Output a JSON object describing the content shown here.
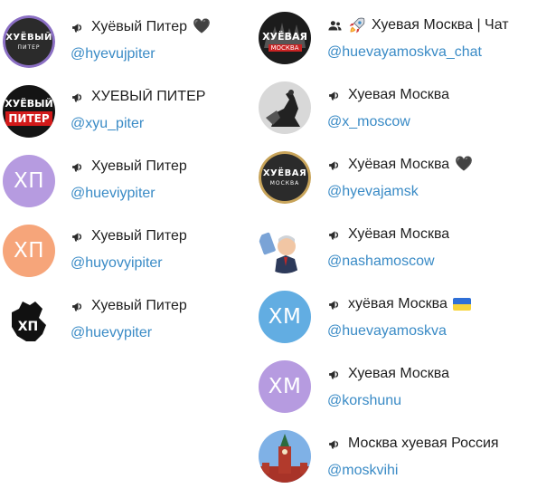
{
  "left": [
    {
      "name": "Хуёвый Питер",
      "handle": "@hyevujpiter",
      "suffix": "heart",
      "avatar": {
        "kind": "logo",
        "top": "ХУЁВЫЙ",
        "bottom": "ПИТЕР",
        "bg": "#2b2b2b",
        "ring": "#8b6fc4"
      }
    },
    {
      "name": "ХУЕВЫЙ ПИТЕР",
      "handle": "@xyu_piter",
      "suffix": "",
      "avatar": {
        "kind": "logo2",
        "top": "ХУЁВЫЙ",
        "bottom": "ПИТЕР",
        "bg": "#141414",
        "accent": "#d21a1a"
      }
    },
    {
      "name": "Хуевый Питер",
      "handle": "@hueviypiter",
      "suffix": "",
      "avatar": {
        "kind": "text",
        "text": "ХП",
        "bg": "#b69be0"
      }
    },
    {
      "name": "Хуевый Питер",
      "handle": "@huyovyipiter",
      "suffix": "",
      "avatar": {
        "kind": "text",
        "text": "ХП",
        "bg": "#f6a57a"
      }
    },
    {
      "name": "Хуевый Питер",
      "handle": "@huevypiter",
      "suffix": "",
      "avatar": {
        "kind": "sticker",
        "text": "ХП"
      }
    }
  ],
  "right": [
    {
      "name": "Хуевая Москва | Чат",
      "handle": "@huevayamoskva_chat",
      "suffix": "",
      "group": true,
      "avatar": {
        "kind": "logo3",
        "top": "ХУЁВАЯ",
        "bottom": "МОСКВА",
        "bg": "#1c1c1c"
      }
    },
    {
      "name": "Хуевая Москва",
      "handle": "@x_moscow",
      "suffix": "",
      "avatar": {
        "kind": "photo-statue",
        "bg": "#c9c9c9"
      }
    },
    {
      "name": "Хуёвая Москва",
      "handle": "@hyevajamsk",
      "suffix": "heart",
      "avatar": {
        "kind": "logo",
        "top": "ХУЁВАЯ",
        "bottom": "МОСКВА",
        "bg": "#2b2b2b",
        "ring": "#c8a45a"
      }
    },
    {
      "name": "Хуёвая Москва",
      "handle": "@nashamoscow",
      "suffix": "",
      "avatar": {
        "kind": "cartoon"
      }
    },
    {
      "name": "хуёвая Москва",
      "handle": "@huevayamoskva",
      "suffix": "flag-ua",
      "avatar": {
        "kind": "text",
        "text": "ХМ",
        "bg": "#62ade2"
      }
    },
    {
      "name": "Хуевая Москва",
      "handle": "@korshunu",
      "suffix": "",
      "avatar": {
        "kind": "text",
        "text": "ХМ",
        "bg": "#b69be0"
      }
    },
    {
      "name": "Москва хуевая Россия",
      "handle": "@moskvihi",
      "suffix": "",
      "avatar": {
        "kind": "photo-kremlin"
      }
    }
  ],
  "icons": {
    "channel": "megaphone-icon",
    "group": "group-icon",
    "rocket": "rocket-icon"
  },
  "colors": {
    "link": "#3a8bc6",
    "name": "#1f1f1f",
    "icon": "#2b2b2b"
  }
}
